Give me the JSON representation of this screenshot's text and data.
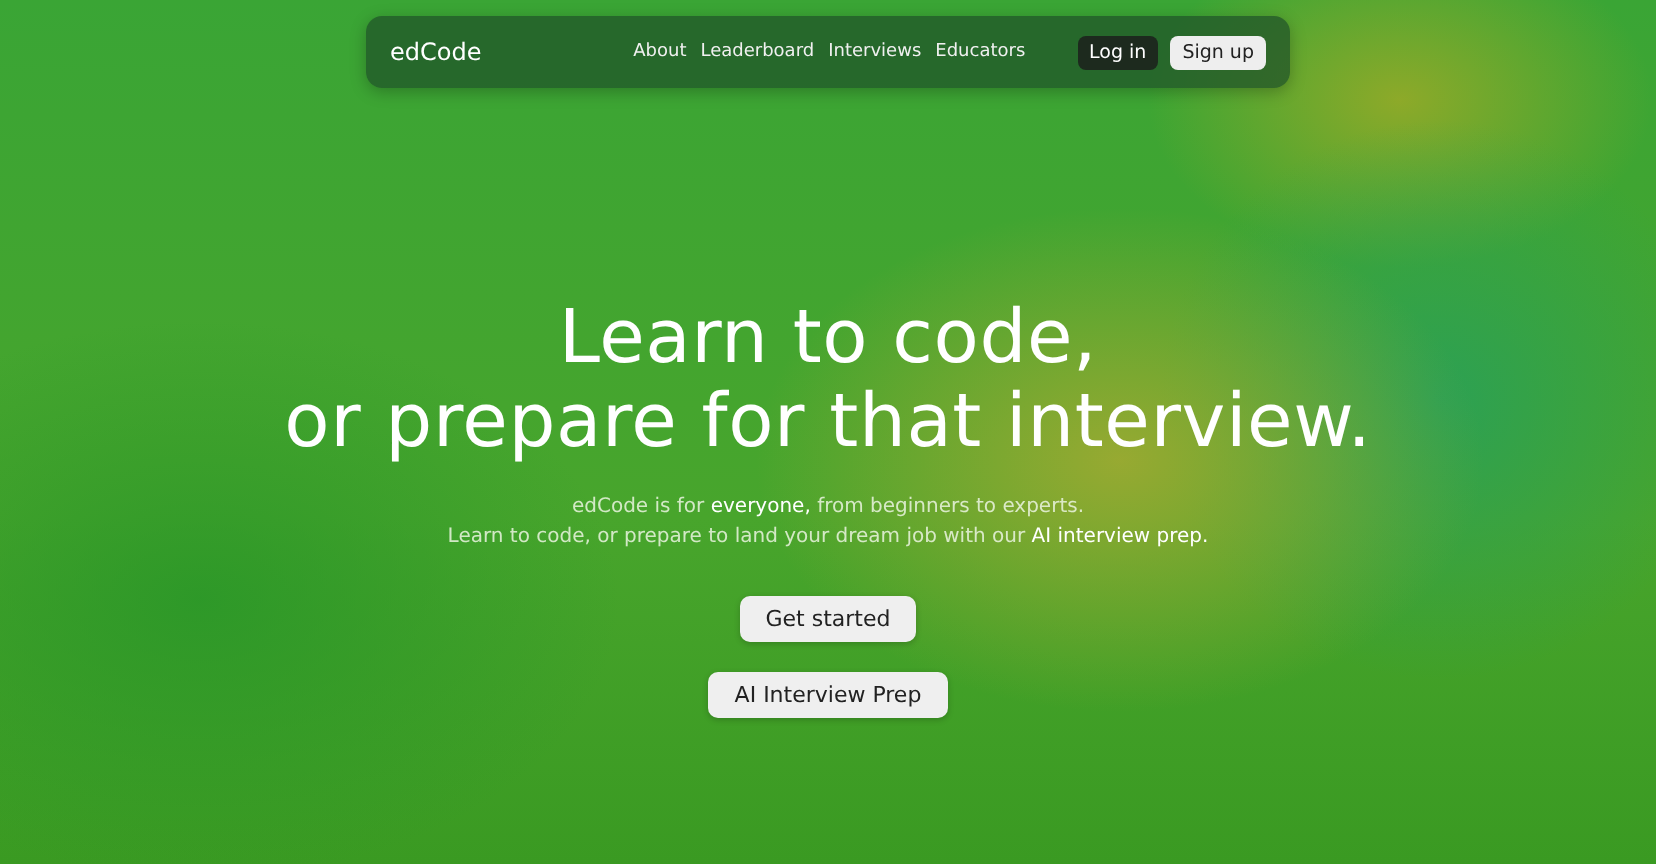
{
  "navbar": {
    "logo": "edCode",
    "links": [
      "About",
      "Leaderboard",
      "Interviews",
      "Educators"
    ],
    "buttons": [
      {
        "label": "Log in",
        "kind": "dark"
      },
      {
        "label": "Sign up",
        "kind": "light"
      }
    ]
  },
  "hero": {
    "title_lines": [
      "Learn to code,",
      "or prepare for that interview."
    ],
    "subtitle_lines": [
      "edCode is for **everyone,** from beginners to experts.",
      "Learn to code, or prepare to land your dream job with our **AI interview prep.**"
    ],
    "buttons": [
      "Get started",
      "AI Interview Prep"
    ]
  }
}
